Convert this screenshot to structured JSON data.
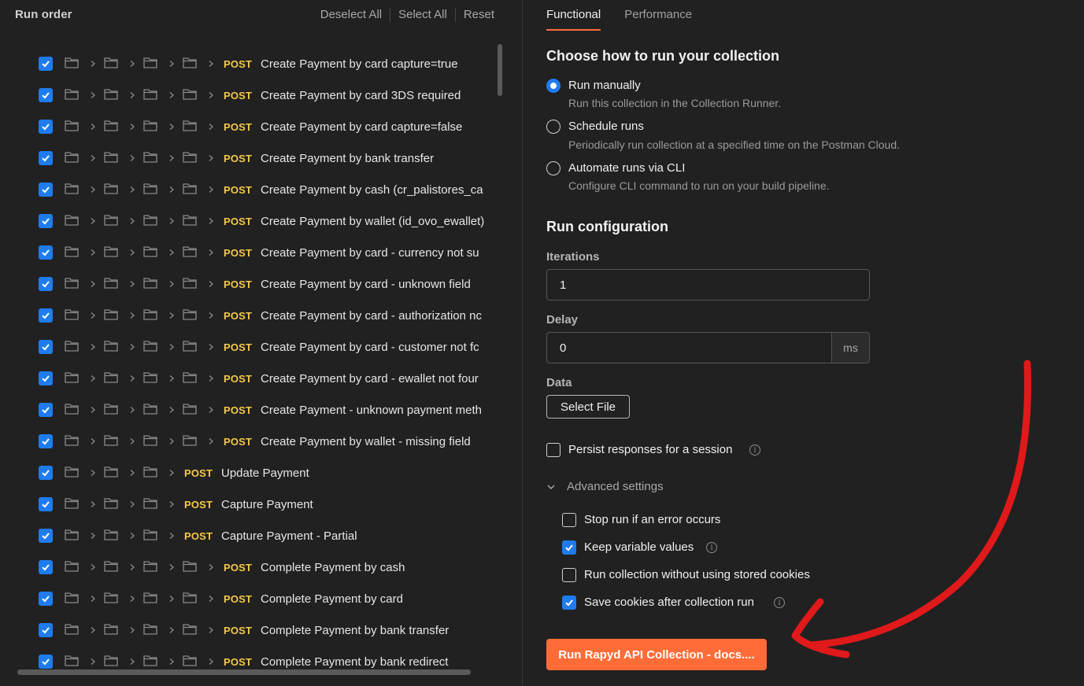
{
  "left": {
    "title": "Run order",
    "actions": [
      "Deselect All",
      "Select All",
      "Reset"
    ],
    "rows": [
      {
        "method": "POST",
        "name": "Create Payment by card capture=true",
        "depth": 4
      },
      {
        "method": "POST",
        "name": "Create Payment by card 3DS required",
        "depth": 4
      },
      {
        "method": "POST",
        "name": "Create Payment by card capture=false",
        "depth": 4
      },
      {
        "method": "POST",
        "name": "Create Payment by bank transfer",
        "depth": 4
      },
      {
        "method": "POST",
        "name": "Create Payment by cash (cr_palistores_ca",
        "depth": 4
      },
      {
        "method": "POST",
        "name": "Create Payment by wallet (id_ovo_ewallet)",
        "depth": 4
      },
      {
        "method": "POST",
        "name": "Create Payment by card - currency not su",
        "depth": 4
      },
      {
        "method": "POST",
        "name": "Create Payment by card - unknown field",
        "depth": 4
      },
      {
        "method": "POST",
        "name": "Create Payment by card - authorization nc",
        "depth": 4
      },
      {
        "method": "POST",
        "name": "Create Payment by card - customer not fc",
        "depth": 4
      },
      {
        "method": "POST",
        "name": "Create Payment by card - ewallet not four",
        "depth": 4
      },
      {
        "method": "POST",
        "name": "Create Payment - unknown payment meth",
        "depth": 4
      },
      {
        "method": "POST",
        "name": "Create Payment by wallet - missing field",
        "depth": 4
      },
      {
        "method": "POST",
        "name": "Update Payment",
        "depth": 3
      },
      {
        "method": "POST",
        "name": "Capture Payment",
        "depth": 3
      },
      {
        "method": "POST",
        "name": "Capture Payment - Partial",
        "depth": 3
      },
      {
        "method": "POST",
        "name": "Complete Payment by cash",
        "depth": 4
      },
      {
        "method": "POST",
        "name": "Complete Payment by card",
        "depth": 4
      },
      {
        "method": "POST",
        "name": "Complete Payment by bank transfer",
        "depth": 4
      },
      {
        "method": "POST",
        "name": "Complete Payment by bank redirect",
        "depth": 4
      }
    ]
  },
  "tabs": [
    "Functional",
    "Performance"
  ],
  "how_to_run": {
    "title": "Choose how to run your collection",
    "options": [
      {
        "label": "Run manually",
        "desc": "Run this collection in the Collection Runner.",
        "selected": true
      },
      {
        "label": "Schedule runs",
        "desc": "Periodically run collection at a specified time on the Postman Cloud.",
        "selected": false
      },
      {
        "label": "Automate runs via CLI",
        "desc": "Configure CLI command to run on your build pipeline.",
        "selected": false
      }
    ]
  },
  "config": {
    "title": "Run configuration",
    "iterations_label": "Iterations",
    "iterations_value": "1",
    "delay_label": "Delay",
    "delay_value": "0",
    "delay_unit": "ms",
    "data_label": "Data",
    "select_file": "Select File",
    "persist_label": "Persist responses for a session",
    "advanced_label": "Advanced settings",
    "advanced": [
      {
        "label": "Stop run if an error occurs",
        "checked": false,
        "info": false
      },
      {
        "label": "Keep variable values",
        "checked": true,
        "info": true
      },
      {
        "label": "Run collection without using stored cookies",
        "checked": false,
        "info": false
      },
      {
        "label": "Save cookies after collection run",
        "checked": true,
        "info": true
      }
    ],
    "run_button": "Run Rapyd API Collection - docs...."
  },
  "colors": {
    "accent": "#ff6c37",
    "checkbox": "#1e7cf0",
    "method": "#f2c94c",
    "annotation_arrow": "#e0191b"
  }
}
